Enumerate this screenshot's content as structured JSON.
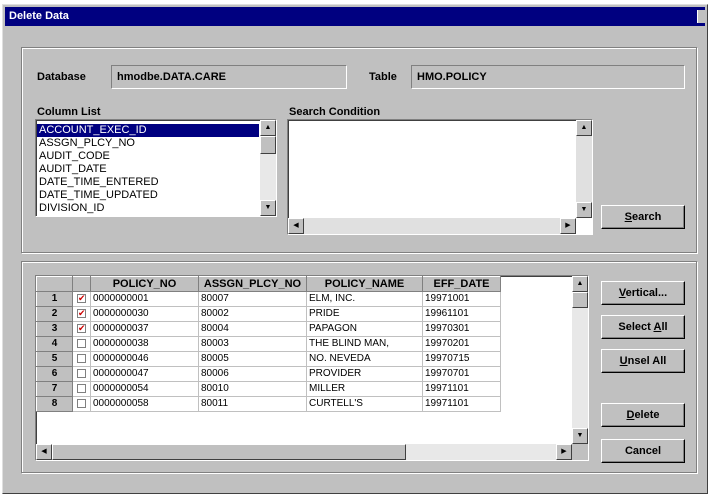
{
  "window": {
    "title": "Delete Data"
  },
  "database": {
    "label": "Database",
    "value": "hmodbe.DATA.CARE"
  },
  "table": {
    "label": "Table",
    "value": "HMO.POLICY"
  },
  "column_list": {
    "label": "Column List",
    "items": [
      "ACCOUNT_EXEC_ID",
      "ASSGN_PLCY_NO",
      "AUDIT_CODE",
      "AUDIT_DATE",
      "DATE_TIME_ENTERED",
      "DATE_TIME_UPDATED",
      "DIVISION_ID"
    ],
    "selected_index": 0
  },
  "search_condition": {
    "label": "Search Condition",
    "value": ""
  },
  "buttons": {
    "search_key": "S",
    "search_rest": "earch",
    "vertical_key": "V",
    "vertical_rest": "ertical...",
    "select_all_pre": "Select ",
    "select_all_key": "A",
    "select_all_rest": "ll",
    "unsel_all_key": "U",
    "unsel_all_rest": "nsel All",
    "delete_key": "D",
    "delete_rest": "elete",
    "cancel": "Cancel"
  },
  "grid": {
    "columns": [
      "POLICY_NO",
      "ASSGN_PLCY_NO",
      "POLICY_NAME",
      "EFF_DATE"
    ],
    "rows": [
      {
        "num": "1",
        "checked": true,
        "policy_no": "0000000001",
        "assgn": "80007",
        "name": "ELM, INC.",
        "eff": "19971001"
      },
      {
        "num": "2",
        "checked": true,
        "policy_no": "0000000030",
        "assgn": "80002",
        "name": "PRIDE",
        "eff": "19961101"
      },
      {
        "num": "3",
        "checked": true,
        "policy_no": "0000000037",
        "assgn": "80004",
        "name": "PAPAGON",
        "eff": "19970301"
      },
      {
        "num": "4",
        "checked": false,
        "policy_no": "0000000038",
        "assgn": "80003",
        "name": "THE BLIND MAN,",
        "eff": "19970201"
      },
      {
        "num": "5",
        "checked": false,
        "policy_no": "0000000046",
        "assgn": "80005",
        "name": "NO. NEVEDA",
        "eff": "19970715"
      },
      {
        "num": "6",
        "checked": false,
        "policy_no": "0000000047",
        "assgn": "80006",
        "name": "PROVIDER",
        "eff": "19970701"
      },
      {
        "num": "7",
        "checked": false,
        "policy_no": "0000000054",
        "assgn": "80010",
        "name": "MILLER",
        "eff": "19971101"
      },
      {
        "num": "8",
        "checked": false,
        "policy_no": "0000000058",
        "assgn": "80011",
        "name": "CURTELL'S",
        "eff": "19971101"
      }
    ]
  },
  "icons": {
    "scroll_up": "scroll-up-icon",
    "scroll_down": "scroll-down-icon",
    "scroll_left": "scroll-left-icon",
    "scroll_right": "scroll-right-icon",
    "check": "check-icon",
    "close": "close-icon"
  },
  "colors": {
    "titlebar": "#000080",
    "selection": "#000080",
    "check": "#cc0000",
    "face": "#c0c0c0"
  }
}
